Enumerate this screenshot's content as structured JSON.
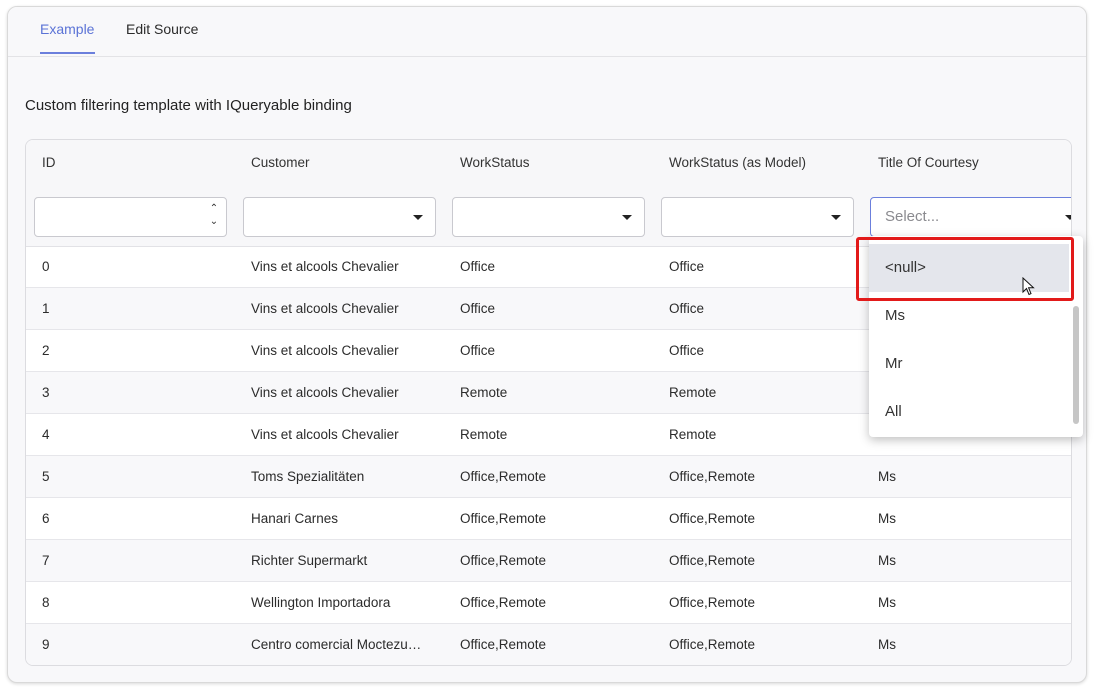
{
  "tabs": [
    {
      "label": "Example"
    },
    {
      "label": "Edit Source"
    }
  ],
  "heading": "Custom filtering template with IQueryable binding",
  "columns": [
    "ID",
    "Customer",
    "WorkStatus",
    "WorkStatus (as Model)",
    "Title Of Courtesy"
  ],
  "filter": {
    "title_placeholder": "Select..."
  },
  "rows": [
    {
      "id": "0",
      "customer": "Vins et alcools Chevalier",
      "status": "Office",
      "status_model": "Office",
      "title": ""
    },
    {
      "id": "1",
      "customer": "Vins et alcools Chevalier",
      "status": "Office",
      "status_model": "Office",
      "title": ""
    },
    {
      "id": "2",
      "customer": "Vins et alcools Chevalier",
      "status": "Office",
      "status_model": "Office",
      "title": ""
    },
    {
      "id": "3",
      "customer": "Vins et alcools Chevalier",
      "status": "Remote",
      "status_model": "Remote",
      "title": ""
    },
    {
      "id": "4",
      "customer": "Vins et alcools Chevalier",
      "status": "Remote",
      "status_model": "Remote",
      "title": ""
    },
    {
      "id": "5",
      "customer": "Toms Spezialitäten",
      "status": "Office,Remote",
      "status_model": "Office,Remote",
      "title": "Ms"
    },
    {
      "id": "6",
      "customer": "Hanari Carnes",
      "status": "Office,Remote",
      "status_model": "Office,Remote",
      "title": "Ms"
    },
    {
      "id": "7",
      "customer": "Richter Supermarkt",
      "status": "Office,Remote",
      "status_model": "Office,Remote",
      "title": "Ms"
    },
    {
      "id": "8",
      "customer": "Wellington Importadora",
      "status": "Office,Remote",
      "status_model": "Office,Remote",
      "title": "Ms"
    },
    {
      "id": "9",
      "customer": "Centro comercial Moctezu…",
      "status": "Office,Remote",
      "status_model": "Office,Remote",
      "title": "Ms"
    }
  ],
  "dropdown": {
    "options": [
      "<null>",
      "Ms",
      "Mr",
      "All"
    ],
    "highlighted": "<null>"
  },
  "colors": {
    "accent": "#5b73d6",
    "highlight_box": "#e21a1a"
  }
}
